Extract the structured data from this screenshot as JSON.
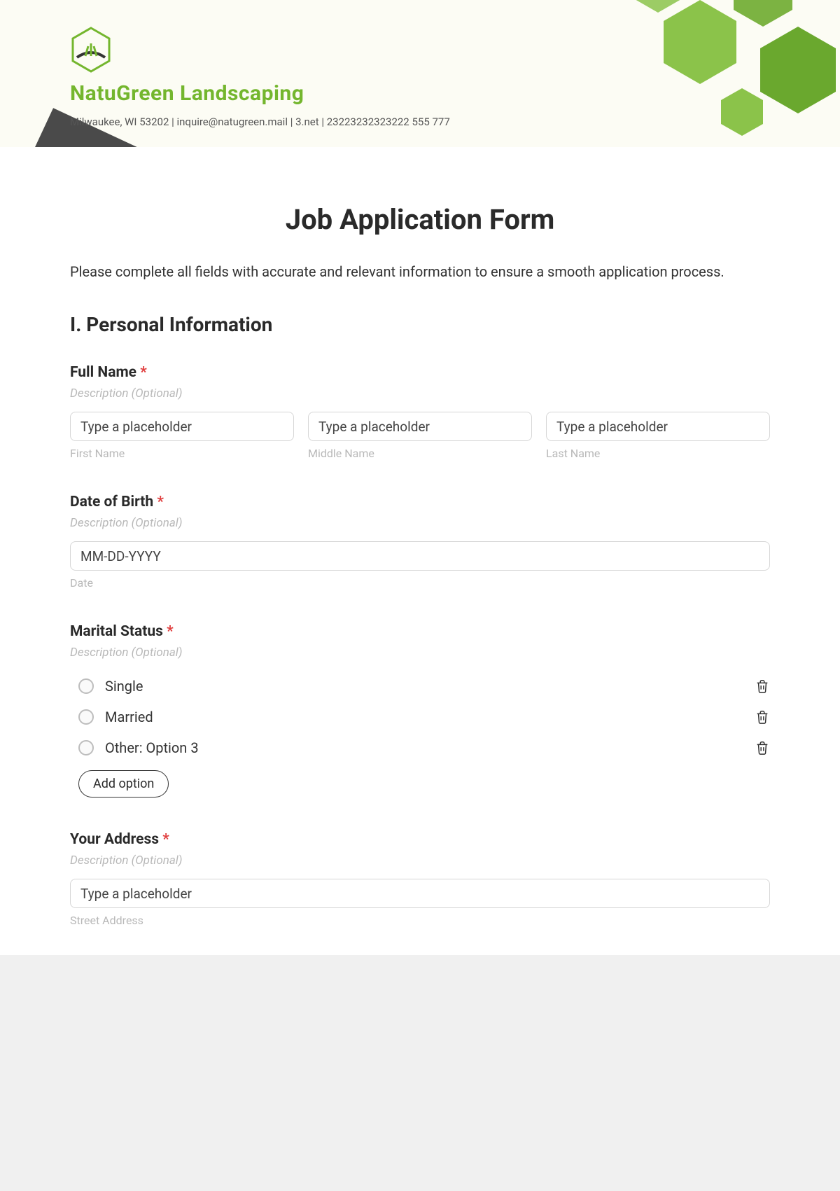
{
  "header": {
    "brand": "NatuGreen Landscaping",
    "contact": "Milwaukee, WI 53202 | inquire@natugreen.mail | 3.net | 23223232323222 555 777"
  },
  "form": {
    "title": "Job Application Form",
    "intro": "Please complete all fields with accurate and relevant information to ensure a smooth application process.",
    "section1_heading": "I. Personal Information",
    "full_name": {
      "label": "Full Name",
      "desc": "Description (Optional)",
      "first_placeholder": "Type a placeholder",
      "first_sub": "First Name",
      "middle_placeholder": "Type a placeholder",
      "middle_sub": "Middle Name",
      "last_placeholder": "Type a placeholder",
      "last_sub": "Last Name"
    },
    "dob": {
      "label": "Date of Birth",
      "desc": "Description (Optional)",
      "placeholder": "MM-DD-YYYY",
      "sub": "Date"
    },
    "marital": {
      "label": "Marital Status",
      "desc": "Description (Optional)",
      "options": [
        "Single",
        "Married",
        "Other: Option 3"
      ],
      "add_label": "Add option"
    },
    "address": {
      "label": "Your Address",
      "desc": "Description (Optional)",
      "street_placeholder": "Type a placeholder",
      "street_sub": "Street Address"
    }
  }
}
